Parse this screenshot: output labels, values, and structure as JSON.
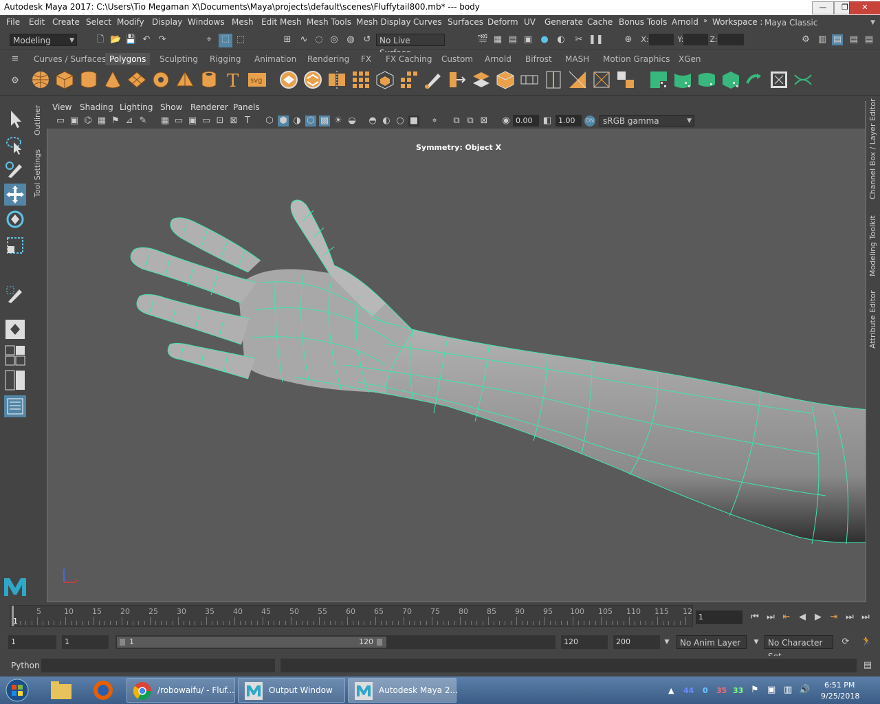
{
  "window": {
    "title": "Autodesk Maya 2017: C:\\Users\\Tio Megaman X\\Documents\\Maya\\projects\\default\\scenes\\Fluffytail800.mb*   ---   body",
    "minimize": "—",
    "restore": "❐",
    "close": "✕"
  },
  "menubar": {
    "items": [
      "File",
      "Edit",
      "Create",
      "Select",
      "Modify",
      "Display",
      "Windows",
      "Mesh",
      "Edit Mesh",
      "Mesh Tools",
      "Mesh Display",
      "Curves",
      "Surfaces",
      "Deform",
      "UV",
      "Generate",
      "Cache",
      "Bonus Tools",
      "Arnold"
    ],
    "workspace_label": "Workspace :",
    "workspace_value": "Maya Classic"
  },
  "statusline": {
    "mode": "Modeling",
    "live_surface": "No Live Surface",
    "x_label": "X:",
    "y_label": "Y:",
    "z_label": "Z:"
  },
  "shelf": {
    "tabs": [
      "Curves / Surfaces",
      "Polygons",
      "Sculpting",
      "Rigging",
      "Animation",
      "Rendering",
      "FX",
      "FX Caching",
      "Custom",
      "Arnold",
      "Bifrost",
      "MASH",
      "Motion Graphics",
      "XGen"
    ],
    "active_tab": "Polygons"
  },
  "side_tabs": {
    "left": [
      "Outliner",
      "Tool Settings"
    ],
    "right": [
      "Channel Box / Layer Editor",
      "Modeling Toolkit",
      "Attribute Editor"
    ]
  },
  "viewport": {
    "menu": [
      "View",
      "Shading",
      "Lighting",
      "Show",
      "Renderer",
      "Panels"
    ],
    "exposure": "0.00",
    "gamma": "1.00",
    "color_space": "sRGB gamma",
    "symmetry": "Symmetry: Object X",
    "axis_z": "z",
    "axis_x": "x"
  },
  "timeslider": {
    "ticks": [
      "5",
      "10",
      "15",
      "20",
      "25",
      "30",
      "35",
      "40",
      "45",
      "50",
      "55",
      "60",
      "65",
      "70",
      "75",
      "80",
      "85",
      "90",
      "95",
      "100",
      "105",
      "110",
      "115",
      "12"
    ],
    "current_frame_marker": "1",
    "current_frame": "1"
  },
  "range": {
    "start": "1",
    "playback_start": "1",
    "slider_start": "1",
    "slider_end": "120",
    "playback_end": "120",
    "end": "200",
    "anim_layer": "No Anim Layer",
    "character_set": "No Character Set"
  },
  "cmdline": {
    "label": "Python"
  },
  "taskbar": {
    "tasks": [
      "/robowaifu/ - Fluf...",
      "Output Window",
      "Autodesk Maya 2..."
    ],
    "tray_numbers": [
      "44",
      "0",
      "35",
      "33"
    ],
    "time": "6:51 PM",
    "date": "9/25/2018"
  },
  "colors": {
    "wire": "#3ee6a8",
    "accent": "#5285a6",
    "shelf_orange": "#e8a04c",
    "shelf_green": "#38b87c"
  }
}
